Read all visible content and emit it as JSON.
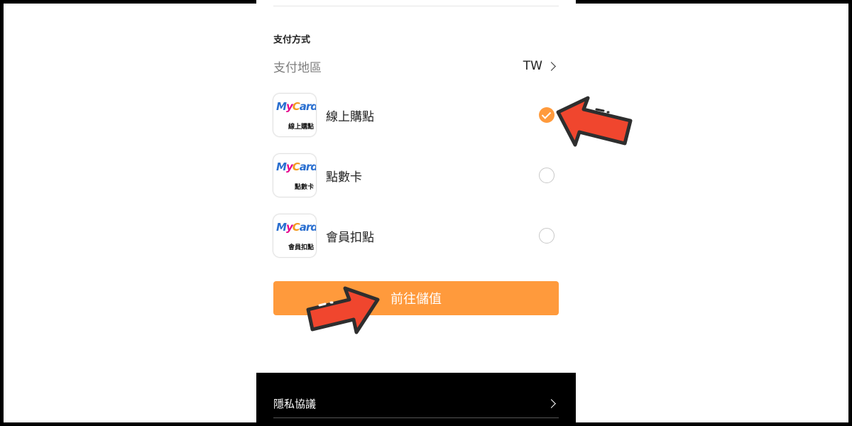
{
  "payment": {
    "section_title": "支付方式",
    "region_label": "支付地區",
    "region_value": "TW",
    "methods": [
      {
        "label": "線上購點",
        "logo_text": "線上購點",
        "selected": true
      },
      {
        "label": "點數卡",
        "logo_text": "點數卡",
        "selected": false
      },
      {
        "label": "會員扣點",
        "logo_text": "會員扣點",
        "selected": false
      }
    ],
    "logo_brand": {
      "m": "M",
      "y": "y",
      "c": "C",
      "rd": "ard"
    }
  },
  "submit_label": "前往儲值",
  "footer": {
    "privacy_label": "隱私協議"
  },
  "colors": {
    "accent": "#ff9a3c",
    "arrow_red": "#f0462e",
    "footer_bg": "#000000"
  },
  "annotations": {
    "arrow_icon": "red-pointer-arrow"
  }
}
